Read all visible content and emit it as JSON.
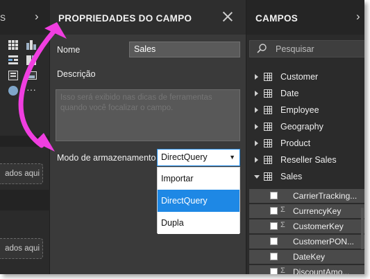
{
  "viz_panel": {
    "header_fragment": "S",
    "expand_glyph": "›",
    "drop_zone_1": "ados aqui",
    "drop_zone_2": "ados aqui"
  },
  "properties": {
    "title": "PROPRIEDADES DO CAMPO",
    "name_label": "Nome",
    "name_value": "Sales",
    "description_label": "Descrição",
    "description_placeholder": "Isso será exibido nas dicas de ferramentas quando você focalizar o campo.",
    "storage_label": "Modo de armazenamento",
    "storage_selected": "DirectQuery",
    "storage_options": [
      "Importar",
      "DirectQuery",
      "Dupla"
    ]
  },
  "fields": {
    "title": "CAMPOS",
    "expand_glyph": "›",
    "search_placeholder": "Pesquisar",
    "tables": [
      "Customer",
      "Date",
      "Employee",
      "Geography",
      "Product",
      "Reseller Sales",
      "Sales"
    ],
    "sales_fields": [
      "CarrierTracking...",
      "CurrencyKey",
      "CustomerKey",
      "CustomerPON...",
      "DateKey",
      "DiscountAmo..."
    ]
  },
  "colors": {
    "accent_blue": "#1e88e5",
    "annotation_pink": "#f03ee0"
  }
}
